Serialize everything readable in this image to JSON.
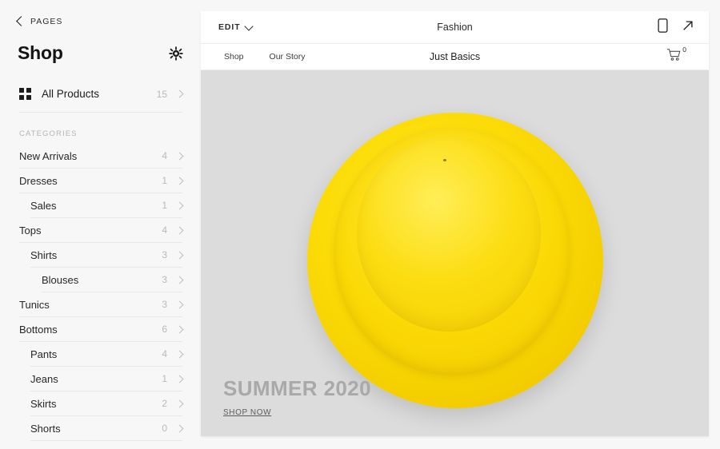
{
  "sidebar": {
    "back_label": "PAGES",
    "title": "Shop",
    "settings_icon": "gear-icon",
    "all_products": {
      "label": "All Products",
      "count": "15",
      "icon": "grid-icon"
    },
    "categories_header": "CATEGORIES",
    "categories": [
      {
        "label": "New Arrivals",
        "count": "4",
        "level": 0
      },
      {
        "label": "Dresses",
        "count": "1",
        "level": 0
      },
      {
        "label": "Sales",
        "count": "1",
        "level": 1
      },
      {
        "label": "Tops",
        "count": "4",
        "level": 0
      },
      {
        "label": "Shirts",
        "count": "3",
        "level": 1
      },
      {
        "label": "Blouses",
        "count": "3",
        "level": 2
      },
      {
        "label": "Tunics",
        "count": "3",
        "level": 0
      },
      {
        "label": "Bottoms",
        "count": "6",
        "level": 0
      },
      {
        "label": "Pants",
        "count": "4",
        "level": 1
      },
      {
        "label": "Jeans",
        "count": "1",
        "level": 1
      },
      {
        "label": "Skirts",
        "count": "2",
        "level": 1
      },
      {
        "label": "Shorts",
        "count": "0",
        "level": 1
      }
    ]
  },
  "preview": {
    "edit_label": "EDIT",
    "site_title": "Fashion",
    "mobile_icon": "mobile-preview-icon",
    "open_icon": "open-external-icon",
    "nav_links": [
      "Shop",
      "Our Story"
    ],
    "brand": "Just Basics",
    "cart_icon": "cart-icon",
    "cart_count": "0",
    "hero": {
      "title": "SUMMER 2020",
      "cta": "SHOP NOW",
      "product_image": "yellow-bucket-hat",
      "accent_color": "#fbd905",
      "background_color": "#dcdcdc"
    }
  }
}
